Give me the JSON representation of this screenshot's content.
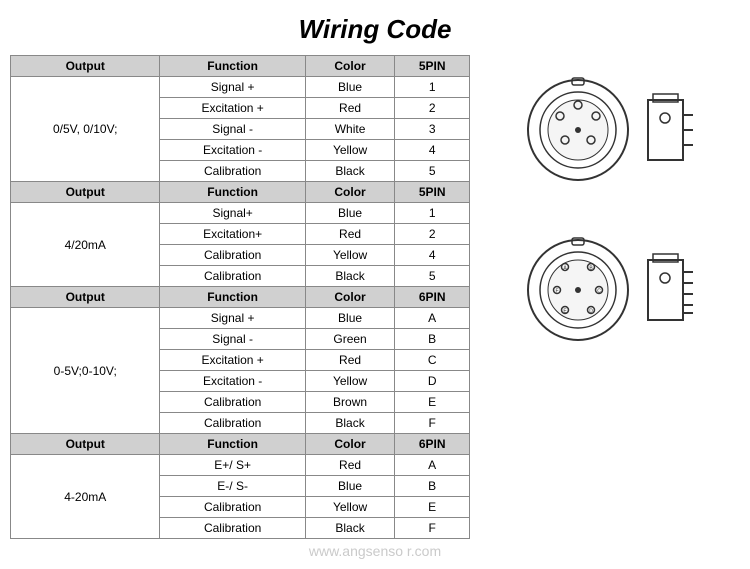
{
  "title": "Wiring Code",
  "table1": {
    "headers": [
      "Output",
      "Function",
      "Color",
      "5PIN"
    ],
    "output_label": "0/5V, 0/10V;",
    "rows": [
      [
        "Signal +",
        "Blue",
        "1"
      ],
      [
        "Excitation +",
        "Red",
        "2"
      ],
      [
        "Signal -",
        "White",
        "3"
      ],
      [
        "Excitation -",
        "Yellow",
        "4"
      ],
      [
        "Calibration",
        "Black",
        "5"
      ]
    ]
  },
  "table2": {
    "headers": [
      "Output",
      "Function",
      "Color",
      "5PIN"
    ],
    "output_label": "4/20mA",
    "rows": [
      [
        "Signal+",
        "Blue",
        "1"
      ],
      [
        "Excitation+",
        "Red",
        "2"
      ],
      [
        "Calibration",
        "Yellow",
        "4"
      ],
      [
        "Calibration",
        "Black",
        "5"
      ]
    ]
  },
  "table3": {
    "headers": [
      "Output",
      "Function",
      "Color",
      "6PIN"
    ],
    "output_label": "0-5V;0-10V;",
    "rows": [
      [
        "Signal +",
        "Blue",
        "A"
      ],
      [
        "Signal -",
        "Green",
        "B"
      ],
      [
        "Excitation +",
        "Red",
        "C"
      ],
      [
        "Excitation -",
        "Yellow",
        "D"
      ],
      [
        "Calibration",
        "Brown",
        "E"
      ],
      [
        "Calibration",
        "Black",
        "F"
      ]
    ]
  },
  "table4": {
    "headers": [
      "Output",
      "Function",
      "Color",
      "6PIN"
    ],
    "output_label": "4-20mA",
    "rows": [
      [
        "E+/ S+",
        "Red",
        "A"
      ],
      [
        "E-/ S-",
        "Blue",
        "B"
      ],
      [
        "Calibration",
        "Yellow",
        "E"
      ],
      [
        "Calibration",
        "Black",
        "F"
      ]
    ]
  },
  "watermark": "www.angsenso r.com"
}
